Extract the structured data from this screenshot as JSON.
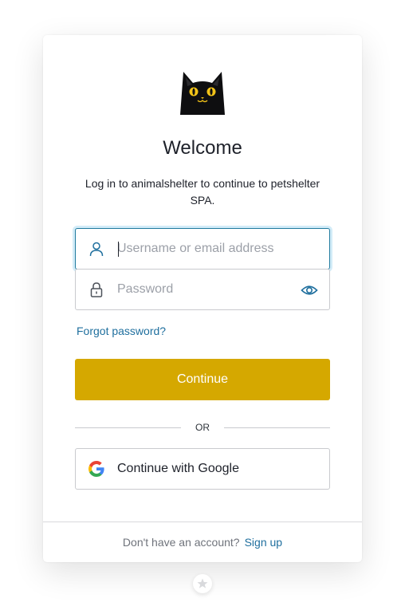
{
  "header": {
    "logo_icon": "black-cat-logo-icon",
    "title": "Welcome",
    "subtitle": "Log in to animalshelter to continue to petshelter SPA."
  },
  "form": {
    "username": {
      "icon": "user-icon",
      "value": "",
      "placeholder": "Username or email address"
    },
    "password": {
      "icon": "lock-icon",
      "value": "",
      "placeholder": "Password",
      "toggle_icon": "eye-icon"
    },
    "forgot_password_label": "Forgot password?",
    "continue_label": "Continue"
  },
  "divider": {
    "label": "OR"
  },
  "social": {
    "google_label": "Continue with Google",
    "google_icon": "google-g-icon"
  },
  "footer": {
    "question": "Don't have an account?",
    "signup_label": "Sign up"
  },
  "colors": {
    "accent": "#d5a800",
    "link": "#1f6f9e",
    "focus_border": "#1f7a9e"
  }
}
